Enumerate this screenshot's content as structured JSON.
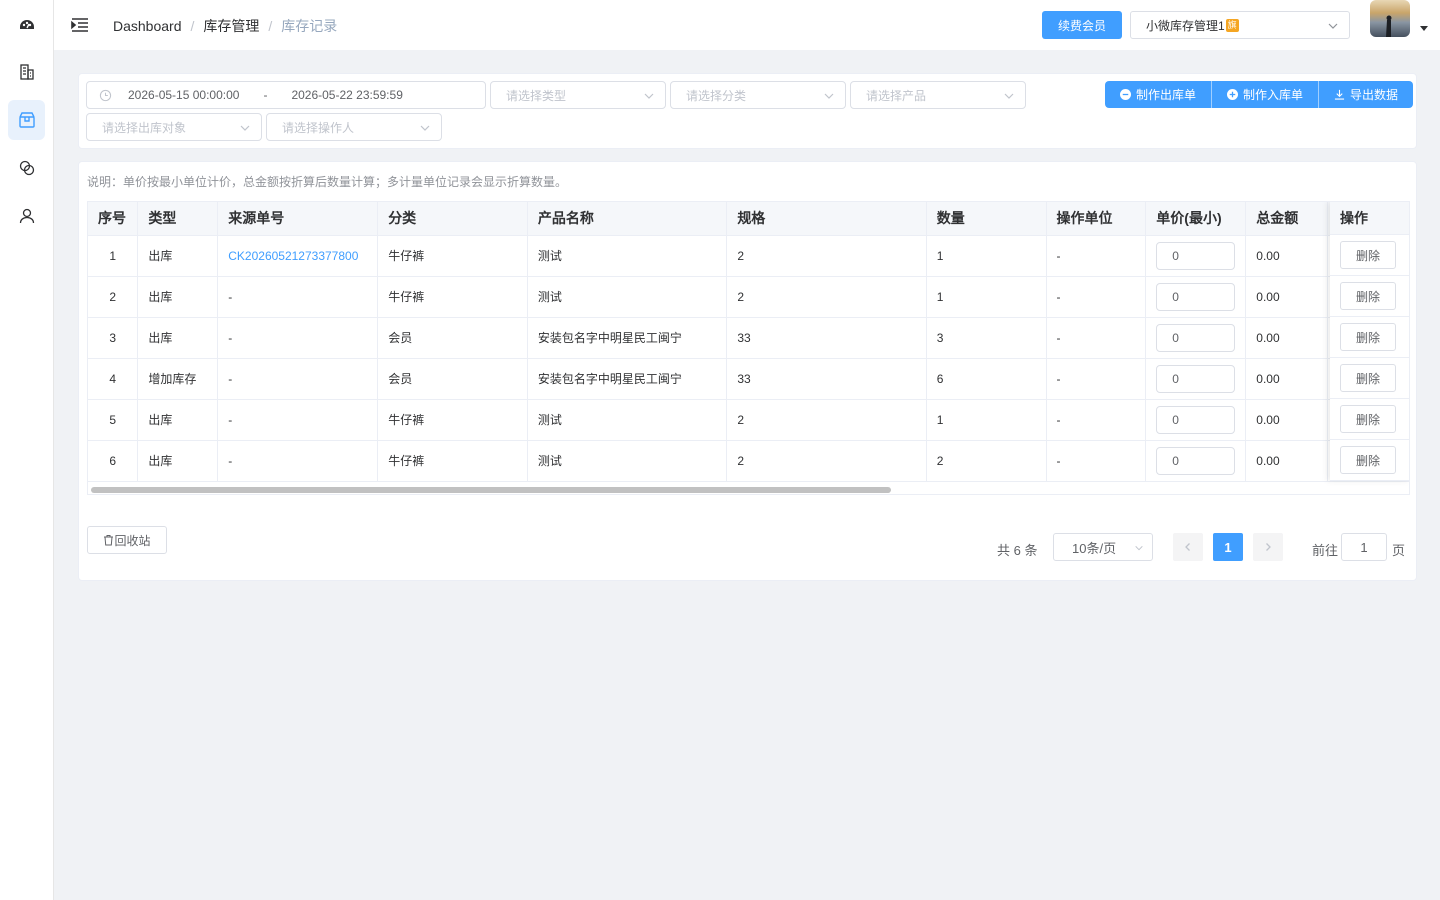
{
  "header": {
    "breadcrumb": [
      "Dashboard",
      "库存管理",
      "库存记录"
    ],
    "renew_label": "续费会员",
    "store_name": "小微库存管理1",
    "store_tag": "旗"
  },
  "filters": {
    "date_start": "2026-05-15 00:00:00",
    "date_sep": "-",
    "date_end": "2026-05-22 23:59:59",
    "type_placeholder": "请选择类型",
    "category_placeholder": "请选择分类",
    "product_placeholder": "请选择产品",
    "target_placeholder": "请选择出库对象",
    "operator_placeholder": "请选择操作人",
    "buttons": {
      "outbound": "制作出库单",
      "inbound": "制作入库单",
      "export": "导出数据"
    }
  },
  "note": "说明：单价按最小单位计价，总金额按折算后数量计算；多计量单位记录会显示折算数量。",
  "table": {
    "columns": [
      "序号",
      "类型",
      "来源单号",
      "分类",
      "产品名称",
      "规格",
      "数量",
      "操作单位",
      "单价(最小)",
      "总金额",
      "操作"
    ],
    "rows": [
      {
        "no": "1",
        "type": "出库",
        "source": "CK20260521273377800",
        "category": "牛仔裤",
        "product": "测试",
        "spec": "2",
        "qty": "1",
        "unit": "-",
        "price": "0",
        "total": "0.00"
      },
      {
        "no": "2",
        "type": "出库",
        "source": "-",
        "category": "牛仔裤",
        "product": "测试",
        "spec": "2",
        "qty": "1",
        "unit": "-",
        "price": "0",
        "total": "0.00"
      },
      {
        "no": "3",
        "type": "出库",
        "source": "-",
        "category": "会员",
        "product": "安装包名字中明星民工闽宁",
        "spec": "33",
        "qty": "3",
        "unit": "-",
        "price": "0",
        "total": "0.00"
      },
      {
        "no": "4",
        "type": "增加库存",
        "source": "-",
        "category": "会员",
        "product": "安装包名字中明星民工闽宁",
        "spec": "33",
        "qty": "6",
        "unit": "-",
        "price": "0",
        "total": "0.00"
      },
      {
        "no": "5",
        "type": "出库",
        "source": "-",
        "category": "牛仔裤",
        "product": "测试",
        "spec": "2",
        "qty": "1",
        "unit": "-",
        "price": "0",
        "total": "0.00"
      },
      {
        "no": "6",
        "type": "出库",
        "source": "-",
        "category": "牛仔裤",
        "product": "测试",
        "spec": "2",
        "qty": "2",
        "unit": "-",
        "price": "0",
        "total": "0.00"
      }
    ],
    "delete_label": "删除"
  },
  "footer": {
    "recycle_label": "回收站",
    "total_text": "共 6 条",
    "page_size": "10条/页",
    "current_page": "1",
    "goto_prefix": "前往",
    "goto_value": "1",
    "goto_suffix": "页"
  },
  "colors": {
    "primary": "#409eff",
    "tag": "#f5a623"
  }
}
